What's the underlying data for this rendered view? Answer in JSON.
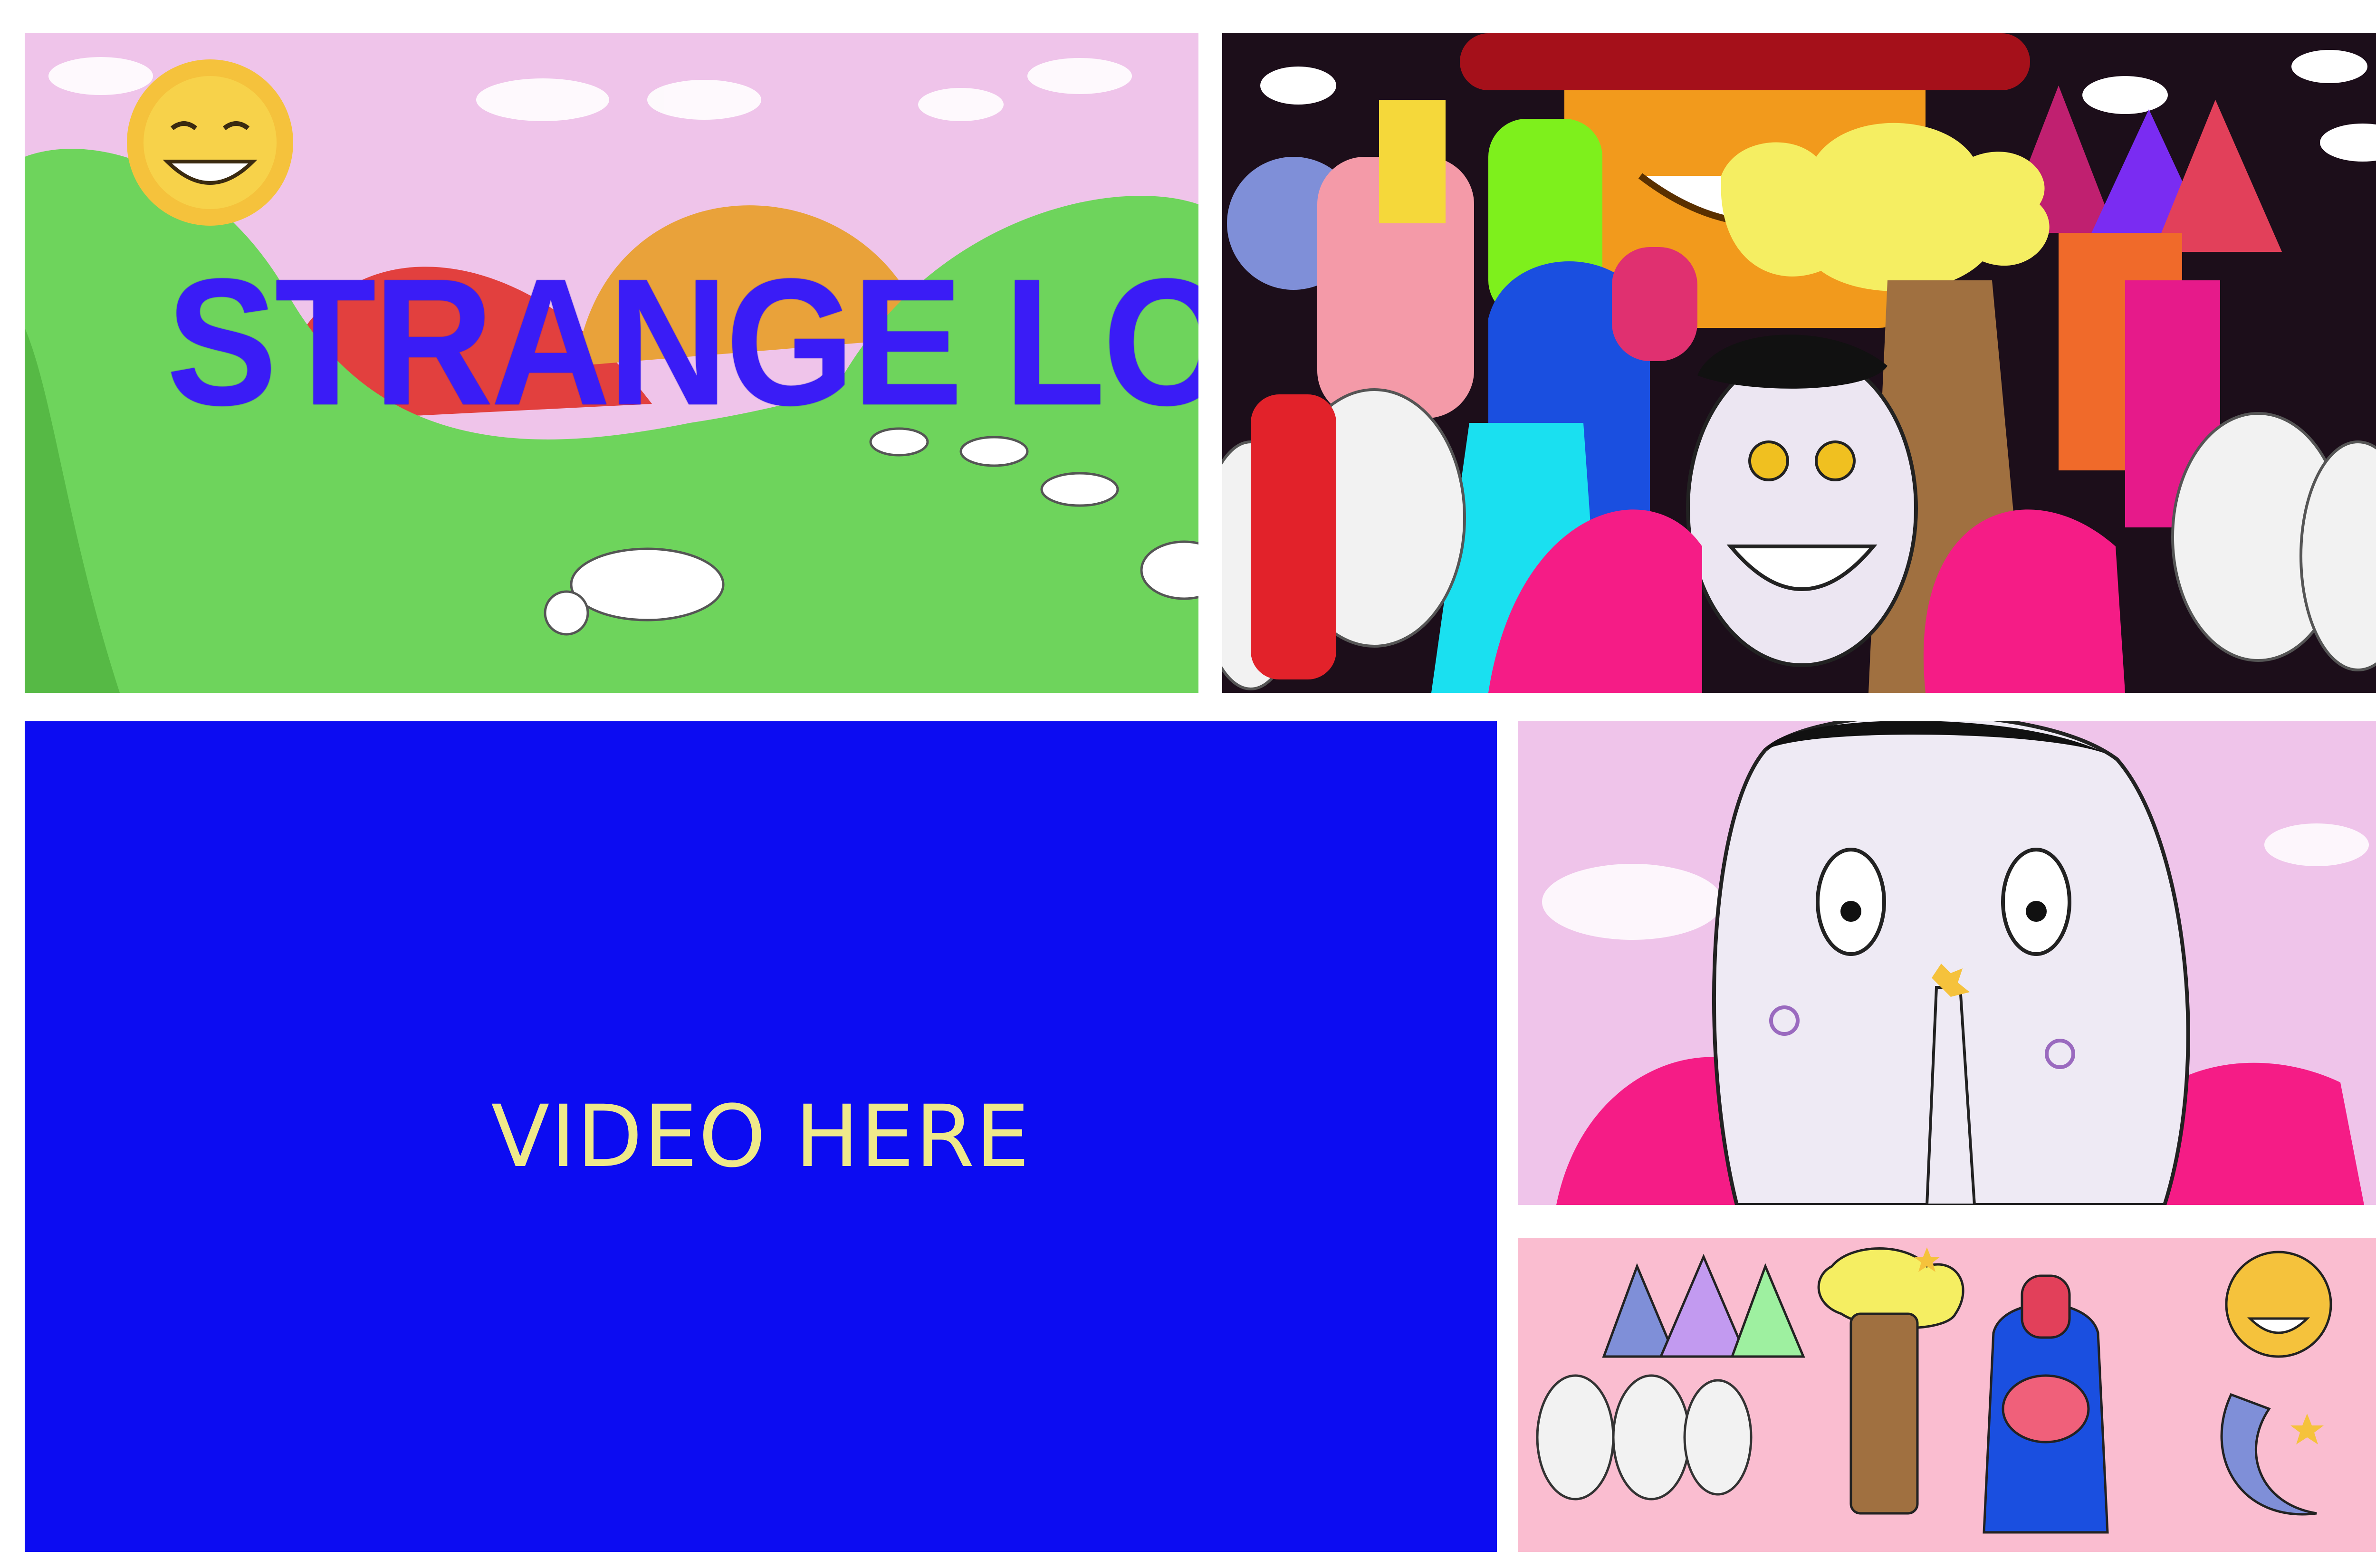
{
  "panels": {
    "title_frame": {
      "title_text": "STRANGE LOVE"
    },
    "video_frame": {
      "placeholder_text": "VIDEO HERE"
    }
  },
  "colors": {
    "title_blue": "#3a1cf6",
    "video_blue": "#0c0cf2",
    "video_text": "#efe98a",
    "sky_pink": "#efc4ea",
    "hill_green": "#6ed45c",
    "hill_red": "#e2403e",
    "hill_orange": "#e9a23a",
    "magenta": "#f51c86"
  }
}
